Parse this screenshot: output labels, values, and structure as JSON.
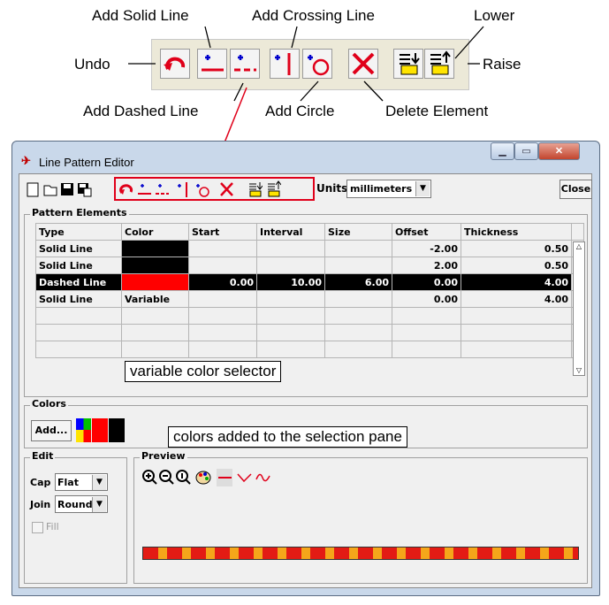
{
  "callouts": {
    "undo": "Undo",
    "add_solid_line": "Add Solid Line",
    "add_crossing_line": "Add Crossing Line",
    "lower": "Lower",
    "raise": "Raise",
    "add_dashed_line": "Add Dashed Line",
    "add_circle": "Add Circle",
    "delete_element": "Delete Element",
    "variable_color_selector": "variable color selector",
    "colors_added": "colors added to the selection pane"
  },
  "window": {
    "title": "Line Pattern Editor",
    "units_label": "Units",
    "units_value": "millimeters",
    "close_label": "Close"
  },
  "pattern_elements": {
    "legend": "Pattern Elements",
    "columns": [
      "Type",
      "Color",
      "Start",
      "Interval",
      "Size",
      "Offset",
      "Thickness"
    ],
    "rows": [
      {
        "type": "Solid Line",
        "color": "#000000",
        "color_text": "",
        "start": "",
        "interval": "",
        "size": "",
        "offset": "-2.00",
        "thickness": "0.50"
      },
      {
        "type": "Solid Line",
        "color": "#000000",
        "color_text": "",
        "start": "",
        "interval": "",
        "size": "",
        "offset": "2.00",
        "thickness": "0.50"
      },
      {
        "type": "Dashed Line",
        "color": "#ff0000",
        "color_text": "",
        "start": "0.00",
        "interval": "10.00",
        "size": "6.00",
        "offset": "0.00",
        "thickness": "4.00",
        "selected": true
      },
      {
        "type": "Solid Line",
        "color": "",
        "color_text": "Variable",
        "start": "",
        "interval": "",
        "size": "",
        "offset": "0.00",
        "thickness": "4.00"
      }
    ]
  },
  "colors": {
    "legend": "Colors",
    "add_label": "Add...",
    "swatches": [
      "variable",
      "#ff0000",
      "#000000"
    ]
  },
  "edit": {
    "legend": "Edit",
    "cap_label": "Cap",
    "cap_value": "Flat",
    "join_label": "Join",
    "join_value": "Round",
    "fill_label": "Fill"
  },
  "preview": {
    "legend": "Preview"
  }
}
